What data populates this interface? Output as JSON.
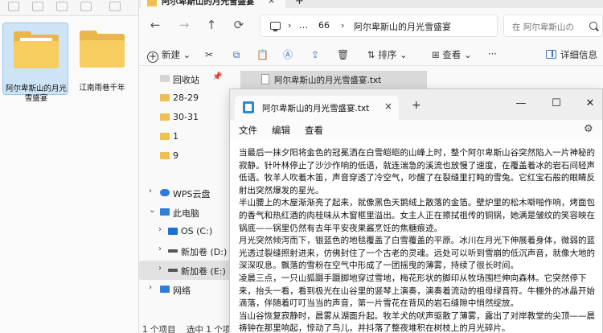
{
  "desktop": {
    "icons": [
      {
        "label": "阿尔卑斯山的月光雪盛宴",
        "selected": true
      },
      {
        "label": "江南雨巷千年",
        "selected": false
      }
    ]
  },
  "explorer": {
    "tab_title": "阿尔卑斯山的月光雪盛宴",
    "tab_close": "×",
    "new_tab": "+",
    "nav": {
      "back": "←",
      "forward": "→",
      "up": "↑",
      "refresh": "⟳"
    },
    "address": {
      "more": "…",
      "count": "66",
      "sep1": "›",
      "sep2": "›",
      "current": "阿尔卑斯山的月光雪盛宴"
    },
    "search": {
      "placeholder": "在 阿尔卑斯山の"
    },
    "commands": {
      "new": "新建",
      "new_caret": "⌄",
      "sort": "排序",
      "sort_caret": "⌄",
      "view": "查看",
      "view_caret": "⌄",
      "more": "···",
      "details": "详细信息"
    },
    "nav_pane": [
      {
        "label": "回收站",
        "icon": "recycle-bin-icon",
        "pinned": true
      },
      {
        "label": "28-29",
        "icon": "folder-icon"
      },
      {
        "label": "30-31",
        "icon": "folder-icon"
      },
      {
        "label": "1",
        "icon": "folder-icon"
      },
      {
        "label": "9",
        "icon": "folder-icon"
      },
      {
        "label": "WPS云盘",
        "icon": "cloud-icon"
      },
      {
        "label": "此电脑",
        "icon": "computer-icon",
        "expanded": true
      },
      {
        "label": "OS (C:)",
        "icon": "os-drive-icon"
      },
      {
        "label": "新加卷 (D:)",
        "icon": "drive-icon"
      },
      {
        "label": "新加卷 (E:)",
        "icon": "drive-icon",
        "selected": true
      },
      {
        "label": "网络",
        "icon": "network-icon"
      }
    ],
    "files": [
      {
        "name": "阿尔卑斯山的月光雪盛宴.txt"
      }
    ],
    "status": {
      "count": "1 个项目",
      "selected": "选中 1 个项目"
    }
  },
  "notepad": {
    "tab_title": "阿尔卑斯山的月光雪盛宴.txt",
    "tab_close": "×",
    "new_tab": "+",
    "controls": {
      "minimize": "—",
      "maximize": "☐",
      "close": "✕"
    },
    "menu": {
      "file": "文件",
      "edit": "编辑",
      "view": "查看"
    },
    "paragraphs": [
      "当最后一抹夕阳将金色的冠冕洒在白雪皑皑的山峰上时，整个阿尔卑斯山谷突然陷入一片神秘的寂静。针叶林停止了沙沙作响的低语，就连湍急的溪流也放慢了速度，在覆盖着冰的岩石间轻声低语。牧羊人吹着木笛，声音穿透了冷空气，吵醒了在裂缝里打盹的雪兔。它红宝石般的眼睛反射出突然爆发的星光。",
      "半山腰上的木屋渐渐亮了起来，就像黑色天鹅绒上散落的金箔。壁炉里的松木噼啪作响，烤面包的香气和热红酒的肉桂味从木窗框里溢出。女主人正在擦拭祖传的铜锅，她满是皱纹的笑容映在锅底——锅里仍然有去年平安夜果酱烹饪的焦糖痕迹。",
      "月光突然倾泻而下，银蓝色的地毯覆盖了白雪覆盖的平原。冰川在月光下伸展着身体，微弱的蓝光透过裂缝照射进来，仿佛封住了一个古老的灵魂。远处可以听到雪崩的低沉声音，就像大地的深深叹息。飘落的雪粉在空气中形成了一团摇曳的薄雾，持续了很长时间。",
      "凌晨三点，一只山狐蹑手蹑脚地穿过雪地，梅花形状的脚印从牧场围栏伸向森林。它突然停下来，抬头一看，看到极光在山谷里的竖琴上演奏，演奏着流动的祖母绿音符。牛棚外的冰晶开始滴落，伴随着叮叮当当的声音，第一片雪花在背风的岩石缝隙中悄然绽放。",
      "当山谷恢复寂静时，晨雾从湖面升起。牧羊犬的吠声驱散了薄雾，露出了对岸教堂的尖顶——晨祷钟在那里响起，惊动了鸟儿，并抖落了整夜堆积在树枝上的月光碎片。"
    ]
  }
}
